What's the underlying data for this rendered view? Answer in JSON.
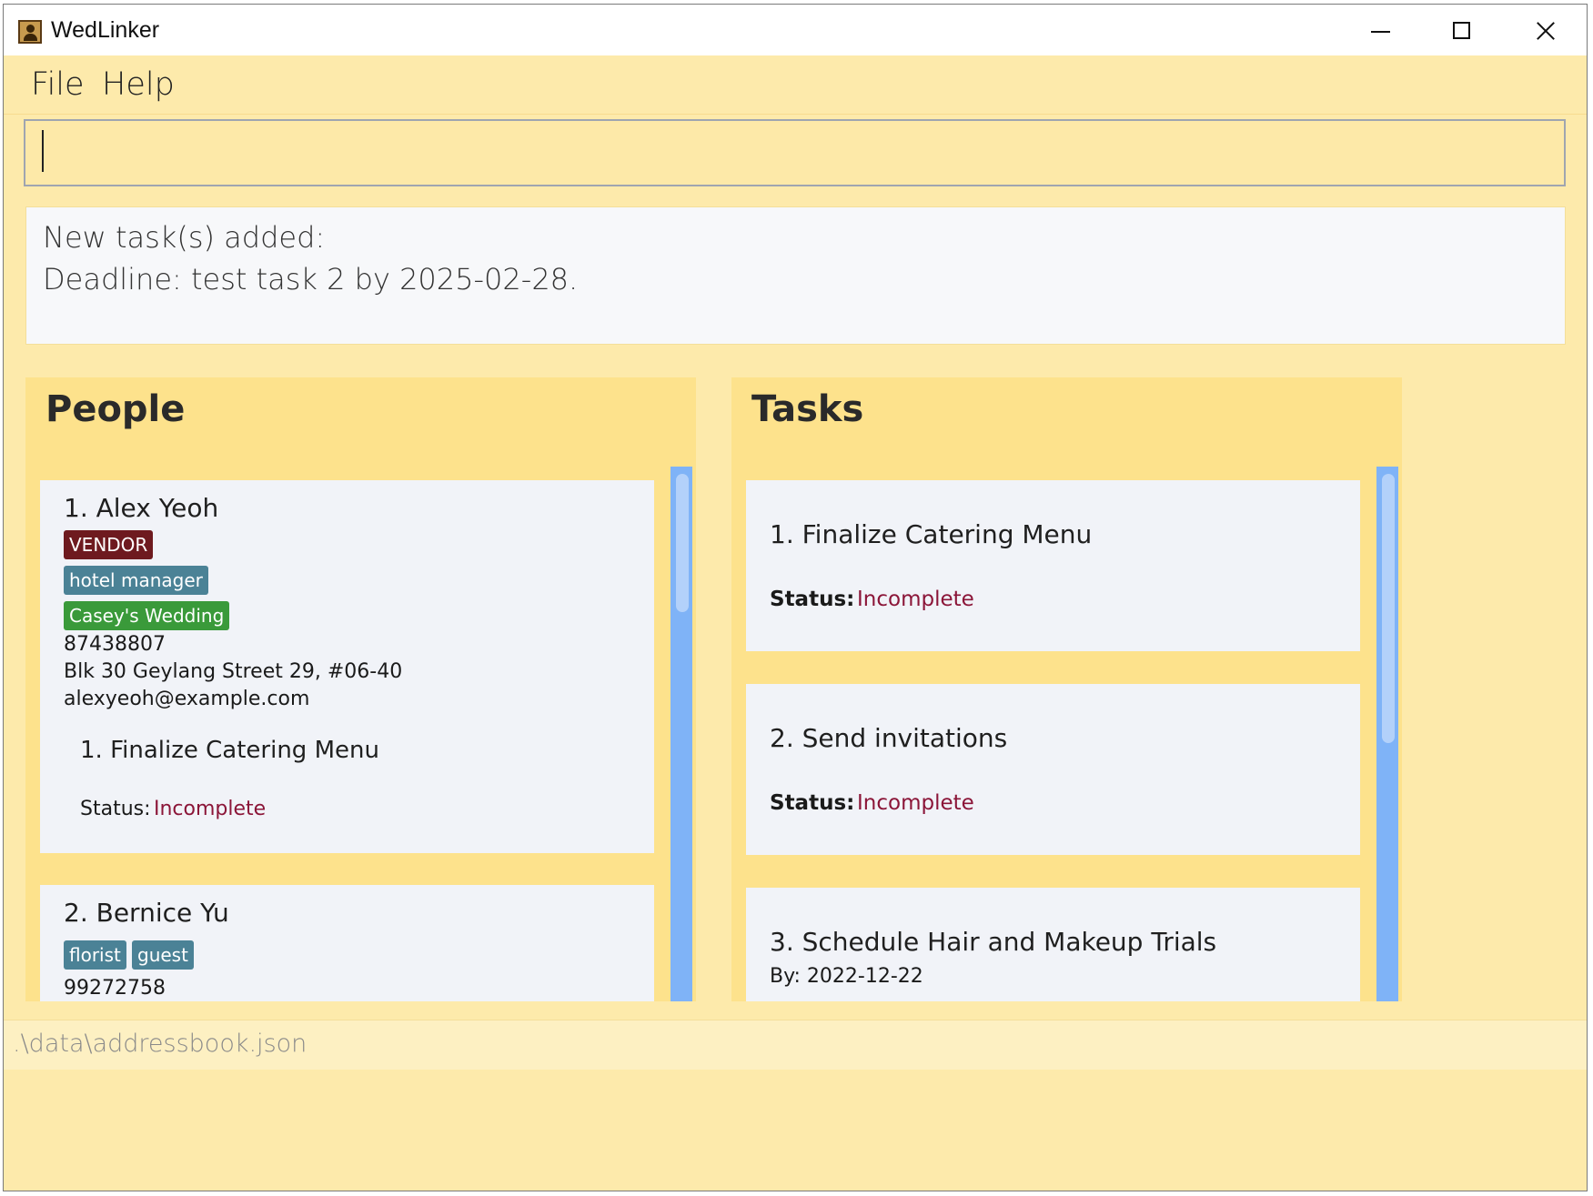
{
  "window": {
    "title": "WedLinker"
  },
  "menu": {
    "file": "File",
    "help": "Help"
  },
  "command": {
    "value": ""
  },
  "result": {
    "line1": "New task(s) added:",
    "line2": "Deadline: test task 2 by 2025-02-28."
  },
  "people": {
    "title": "People",
    "items": [
      {
        "name": "1.  Alex Yeoh",
        "tags": [
          {
            "label": "VENDOR",
            "color": "#6e1a1f"
          },
          {
            "label": "hotel manager",
            "color": "#4b8296"
          },
          {
            "label": "Casey's Wedding",
            "color": "#3a9a3a"
          }
        ],
        "phone": "87438807",
        "address": "Blk 30 Geylang Street 29, #06-40",
        "email": "alexyeoh@example.com",
        "task_title": "1.  Finalize Catering Menu",
        "status_label": "Status:",
        "status_value": "Incomplete"
      },
      {
        "name": "2.  Bernice Yu",
        "tags": [
          {
            "label": "florist",
            "color": "#4b8296"
          },
          {
            "label": "guest",
            "color": "#4b8296"
          }
        ],
        "phone": "99272758"
      }
    ]
  },
  "tasks": {
    "title": "Tasks",
    "items": [
      {
        "title": "1.  Finalize Catering Menu",
        "status_label": "Status:",
        "status_value": "Incomplete"
      },
      {
        "title": "2.  Send invitations",
        "status_label": "Status:",
        "status_value": "Incomplete"
      },
      {
        "title": "3.  Schedule Hair and Makeup Trials",
        "by": "By: 2022-12-22"
      }
    ]
  },
  "statusbar": {
    "path": ".\\data\\addressbook.json"
  },
  "colors": {
    "background": "#fdeaab",
    "panel": "#fde28c",
    "card": "#f1f3f8",
    "scrollbar": "#7fb3f7",
    "status_incomplete": "#8b1538"
  }
}
